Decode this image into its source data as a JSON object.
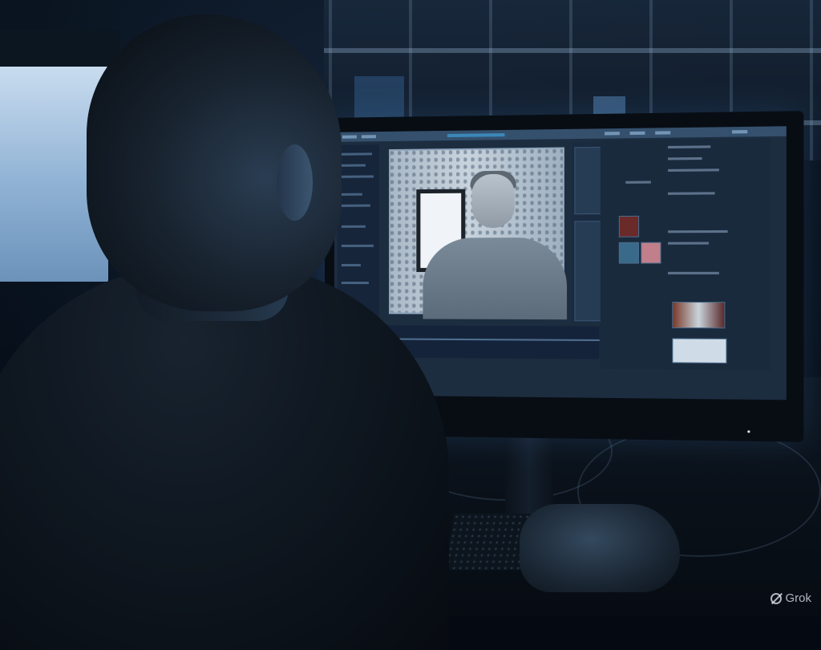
{
  "watermark": {
    "text": "Grok",
    "icon": "grok-logo-icon"
  },
  "colors": {
    "ambient": "#050a12",
    "screen_glow": "#8fb2d4",
    "ui_panel": "#1d2d40"
  }
}
